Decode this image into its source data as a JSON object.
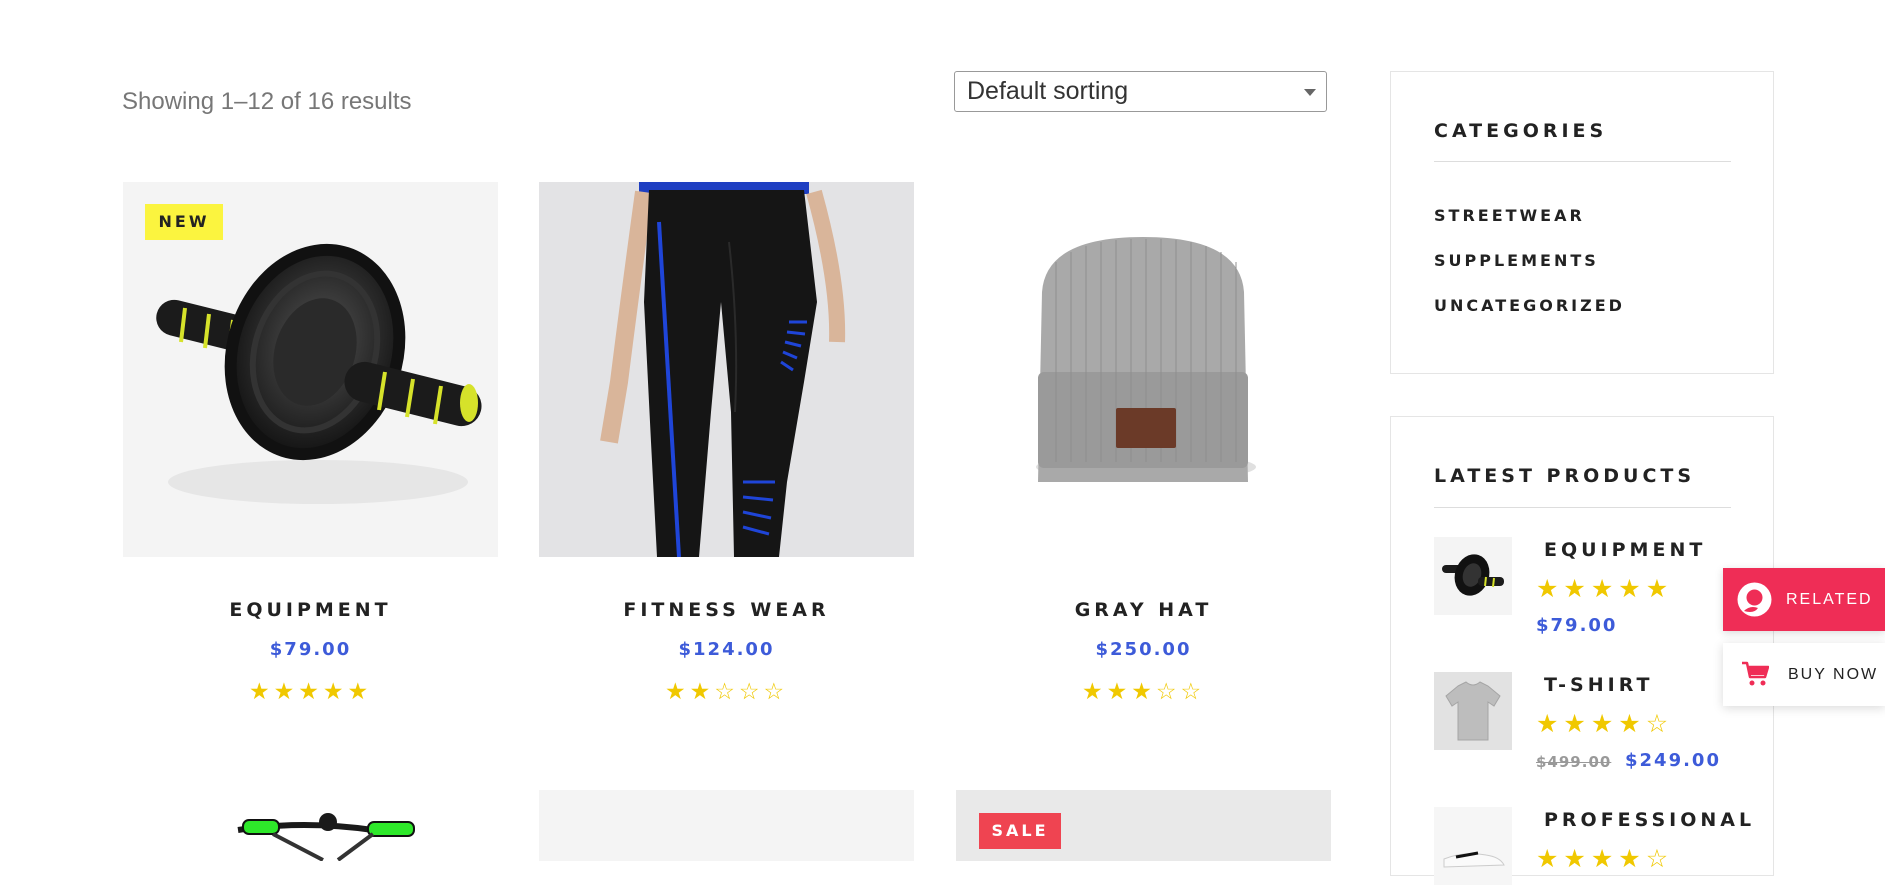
{
  "shop": {
    "results_text": "Showing 1–12 of 16 results",
    "sorting": {
      "selected": "Default sorting"
    }
  },
  "products": [
    {
      "title": "EQUIPMENT",
      "price": "$79.00",
      "rating": 5,
      "badge": "NEW"
    },
    {
      "title": "FITNESS WEAR",
      "price": "$124.00",
      "rating": 2,
      "badge": ""
    },
    {
      "title": "GRAY HAT",
      "price": "$250.00",
      "rating": 3,
      "badge": ""
    },
    {
      "title": "",
      "price": "",
      "rating": null,
      "badge": ""
    },
    {
      "title": "",
      "price": "",
      "rating": null,
      "badge": ""
    },
    {
      "title": "",
      "price": "",
      "rating": null,
      "badge": "SALE"
    }
  ],
  "sidebar": {
    "categories": {
      "title": "CATEGORIES",
      "items": [
        "STREETWEAR",
        "SUPPLEMENTS",
        "UNCATEGORIZED"
      ]
    },
    "latest": {
      "title": "LATEST PRODUCTS",
      "items": [
        {
          "title": "EQUIPMENT",
          "rating": 5,
          "price": "$79.00",
          "old_price": ""
        },
        {
          "title": "T-SHIRT",
          "rating": 4,
          "price": "$249.00",
          "old_price": "$499.00"
        },
        {
          "title": "PROFESSIONAL",
          "rating": 4,
          "price": "",
          "old_price": ""
        }
      ]
    }
  },
  "floating": {
    "related_label": "RELATED",
    "buy_now_label": "BUY NOW"
  },
  "colors": {
    "accent": "#3d5bd9",
    "star": "#f0c800",
    "new_badge": "#fbf43f",
    "sale_badge": "#ef4451",
    "related_bg": "#ef2d56"
  },
  "icons": {
    "sort_caret": "chevron-down-icon",
    "related": "related-logo-icon",
    "buy_now": "cart-icon"
  }
}
